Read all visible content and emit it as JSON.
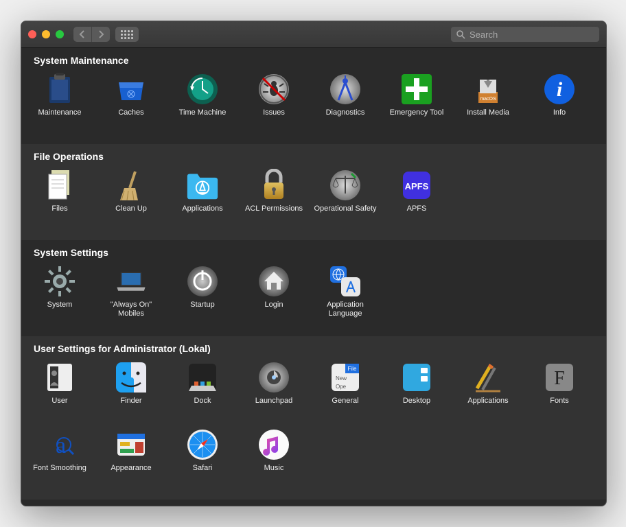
{
  "search_placeholder": "Search",
  "sections": [
    {
      "title": "System Maintenance",
      "alt": false,
      "items": [
        {
          "id": "maintenance",
          "label": "Maintenance"
        },
        {
          "id": "caches",
          "label": "Caches"
        },
        {
          "id": "time-machine",
          "label": "Time Machine"
        },
        {
          "id": "issues",
          "label": "Issues"
        },
        {
          "id": "diagnostics",
          "label": "Diagnostics"
        },
        {
          "id": "emergency-tool",
          "label": "Emergency Tool"
        },
        {
          "id": "install-media",
          "label": "Install Media"
        },
        {
          "id": "info",
          "label": "Info"
        }
      ]
    },
    {
      "title": "File Operations",
      "alt": true,
      "items": [
        {
          "id": "files",
          "label": "Files"
        },
        {
          "id": "clean-up",
          "label": "Clean Up"
        },
        {
          "id": "applications",
          "label": "Applications"
        },
        {
          "id": "acl-permissions",
          "label": "ACL Permissions"
        },
        {
          "id": "operational-safety",
          "label": "Operational Safety"
        },
        {
          "id": "apfs",
          "label": "APFS"
        }
      ]
    },
    {
      "title": "System Settings",
      "alt": false,
      "items": [
        {
          "id": "system",
          "label": "System"
        },
        {
          "id": "always-on-mobiles",
          "label": "\"Always On\" Mobiles"
        },
        {
          "id": "startup",
          "label": "Startup"
        },
        {
          "id": "login",
          "label": "Login"
        },
        {
          "id": "application-language",
          "label": "Application Language"
        }
      ]
    },
    {
      "title": "User Settings for Administrator (Lokal)",
      "alt": true,
      "items": [
        {
          "id": "user",
          "label": "User"
        },
        {
          "id": "finder",
          "label": "Finder"
        },
        {
          "id": "dock",
          "label": "Dock"
        },
        {
          "id": "launchpad",
          "label": "Launchpad"
        },
        {
          "id": "general",
          "label": "General"
        },
        {
          "id": "desktop",
          "label": "Desktop"
        },
        {
          "id": "applications-user",
          "label": "Applications"
        },
        {
          "id": "fonts",
          "label": "Fonts"
        },
        {
          "id": "font-smoothing",
          "label": "Font Smoothing"
        },
        {
          "id": "appearance",
          "label": "Appearance"
        },
        {
          "id": "safari",
          "label": "Safari"
        },
        {
          "id": "music",
          "label": "Music"
        }
      ]
    }
  ]
}
